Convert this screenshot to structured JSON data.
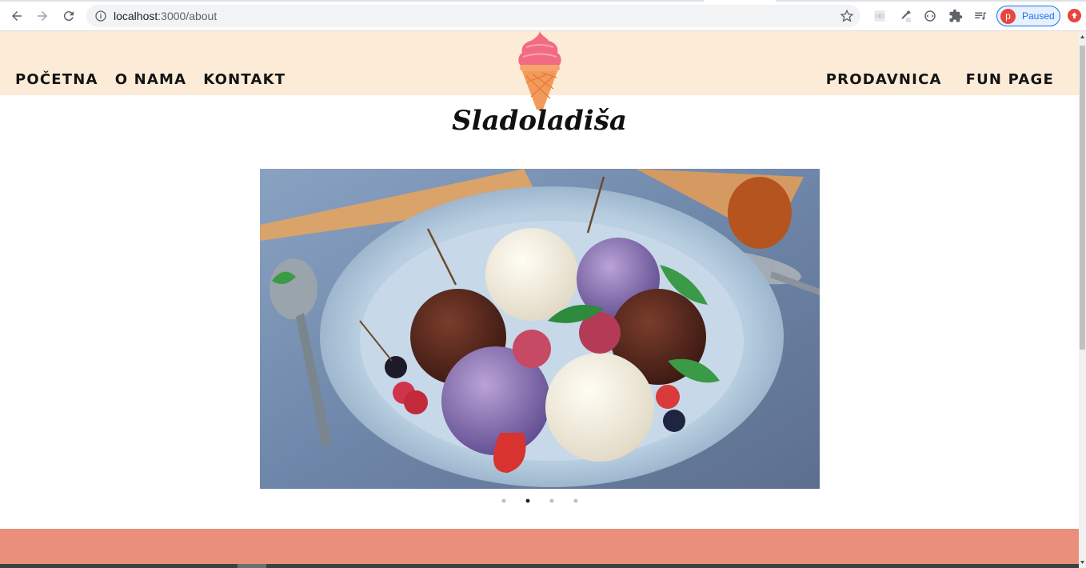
{
  "browser": {
    "url_host": "localhost",
    "url_path": ":3000/about",
    "profile_initial": "p",
    "profile_status": "Paused"
  },
  "nav": {
    "left": [
      "POČETNA",
      "O NAMA",
      "KONTAKT"
    ],
    "right": [
      "PRODAVNICA",
      "FUN PAGE"
    ]
  },
  "brand": {
    "name": "Sladoladiša"
  },
  "carousel": {
    "slide_count": 4,
    "active_index": 1
  },
  "colors": {
    "header_band": "#fbebd7",
    "footer_band": "#ea8f79",
    "nav_text": "#141414",
    "ice_cream_top": "#f36b82",
    "cone": "#f39a5a"
  },
  "icons": [
    "back-icon",
    "forward-icon",
    "reload-icon",
    "info-icon",
    "star-icon",
    "extension-icons",
    "puzzle-icon",
    "playlist-icon",
    "update-icon",
    "ice-cream-logo-icon"
  ]
}
